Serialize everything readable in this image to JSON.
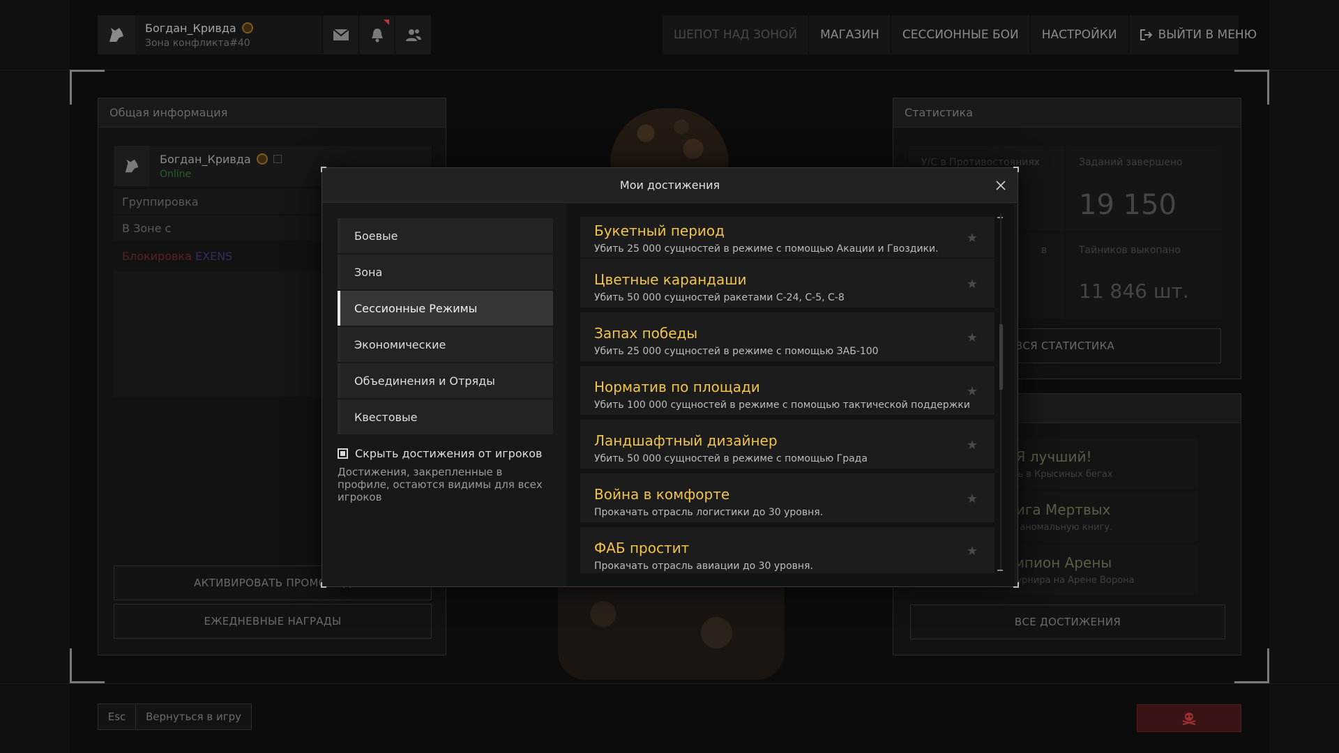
{
  "header": {
    "player_name": "Богдан_Кривда",
    "player_zone": "Зона конфликта#40",
    "icons": [
      "wolf-icon",
      "mail-icon",
      "bell-icon",
      "friends-icon"
    ],
    "nav": [
      {
        "label": "ШЕПОТ НАД ЗОНОЙ",
        "dimmed": true
      },
      {
        "label": "МАГАЗИН",
        "dimmed": false
      },
      {
        "label": "СЕССИОННЫЕ БОИ",
        "dimmed": false
      },
      {
        "label": "НАСТРОЙКИ",
        "dimmed": false
      },
      {
        "label": "ВЫЙТИ В МЕНЮ",
        "dimmed": false
      }
    ]
  },
  "info_panel": {
    "title": "Общая информация",
    "name": "Богдан_Кривда",
    "status": "Online",
    "status_color": "#2fa33a",
    "rows": [
      "Группировка",
      "В Зоне с"
    ],
    "block_text_prefix": "Блокировка",
    "block_text_suffix": "EXENS",
    "promo_button": "АКТИВИРОВАТЬ ПРОМОКОД",
    "daily_button": "ЕЖЕДНЕВНЫЕ НАГРАДЫ"
  },
  "stats_panel": {
    "title": "Статистика",
    "cells": [
      {
        "label": "У/С в Противостояниях",
        "value": ""
      },
      {
        "label": "Заданий завершено",
        "value": "19 150"
      },
      {
        "label": "в",
        "value": ""
      },
      {
        "label": "Тайников выкопано",
        "value": "11 846 шт."
      }
    ],
    "all_stats_button": "ВСЯ СТАТИСТИКА"
  },
  "achievements_panel": {
    "items": [
      {
        "title": "Я лучший!",
        "subtitle": "едить в Крысиных бегах"
      },
      {
        "title": "Книга Мертвых",
        "subtitle": "нуть аномальную книгу."
      },
      {
        "title": "Чемпион Арены",
        "subtitle": "ителем турнира на Арене Ворона"
      }
    ],
    "all_button": "ВСЕ ДОСТИЖЕНИЯ"
  },
  "modal": {
    "title": "Мои достижения",
    "categories": [
      {
        "label": "Боевые",
        "active": false
      },
      {
        "label": "Зона",
        "active": false
      },
      {
        "label": "Сессионные Режимы",
        "active": true
      },
      {
        "label": "Экономические",
        "active": false
      },
      {
        "label": "Объединения и Отряды",
        "active": false
      },
      {
        "label": "Квестовые",
        "active": false
      }
    ],
    "hide_checkbox_label": "Скрыть достижения от игроков",
    "hide_checkbox_checked": true,
    "hide_note": "Достижения, закрепленные в профиле, остаются видимы для всех игроков",
    "achievements": [
      {
        "title": "Букетный период",
        "description": "Убить 25 000 сущностей в режиме с помощью Акации и Гвоздики."
      },
      {
        "title": "Цветные карандаши",
        "description": "Убить 50 000 сущностей ракетами С-24, С-5, С-8"
      },
      {
        "title": "Запах победы",
        "description": "Убить 25 000 сущностей в режиме с помощью ЗАБ-100"
      },
      {
        "title": "Норматив по площади",
        "description": "Убить 100 000 сущностей в режиме с помощью тактической поддержки"
      },
      {
        "title": "Ландшафтный дизайнер",
        "description": "Убить 50 000 сущностей в режиме с помощью Града"
      },
      {
        "title": "Война в комфорте",
        "description": "Прокачать отрасль логистики до 30 уровня."
      },
      {
        "title": "ФАБ простит",
        "description": "Прокачать отрасль авиации до 30 уровня."
      }
    ]
  },
  "footer": {
    "esc_key": "Esc",
    "back_label": "Вернуться в игру"
  },
  "colors": {
    "accent_gold": "#f0c44a",
    "report_red": "#3a1414"
  }
}
